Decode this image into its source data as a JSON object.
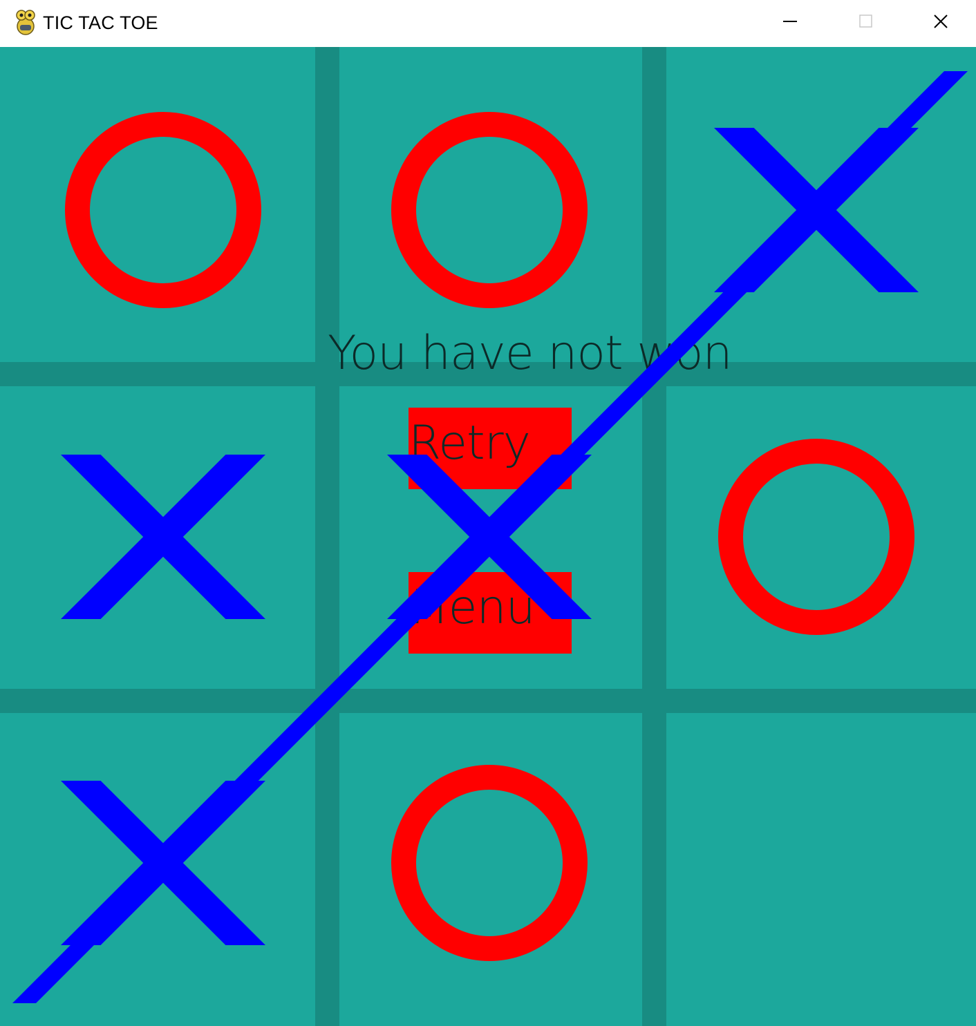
{
  "window": {
    "title": "TIC TAC TOE",
    "controls": [
      "minimize",
      "maximize",
      "close"
    ]
  },
  "colors": {
    "grid_line": "#188c82",
    "cell": "#1ca89c",
    "o_mark": "#ff0000",
    "x_mark": "#0000ff",
    "win_line": "#0000ff",
    "button": "#ff0000",
    "text": "#0c2a28"
  },
  "game": {
    "board": [
      [
        "O",
        "O",
        "X"
      ],
      [
        "X",
        "X",
        "O"
      ],
      [
        "X",
        "O",
        ""
      ]
    ],
    "winning_line": "anti-diagonal",
    "status_message": "You have not won"
  },
  "buttons": {
    "retry_label": "Retry",
    "menu_label": "Menu"
  }
}
